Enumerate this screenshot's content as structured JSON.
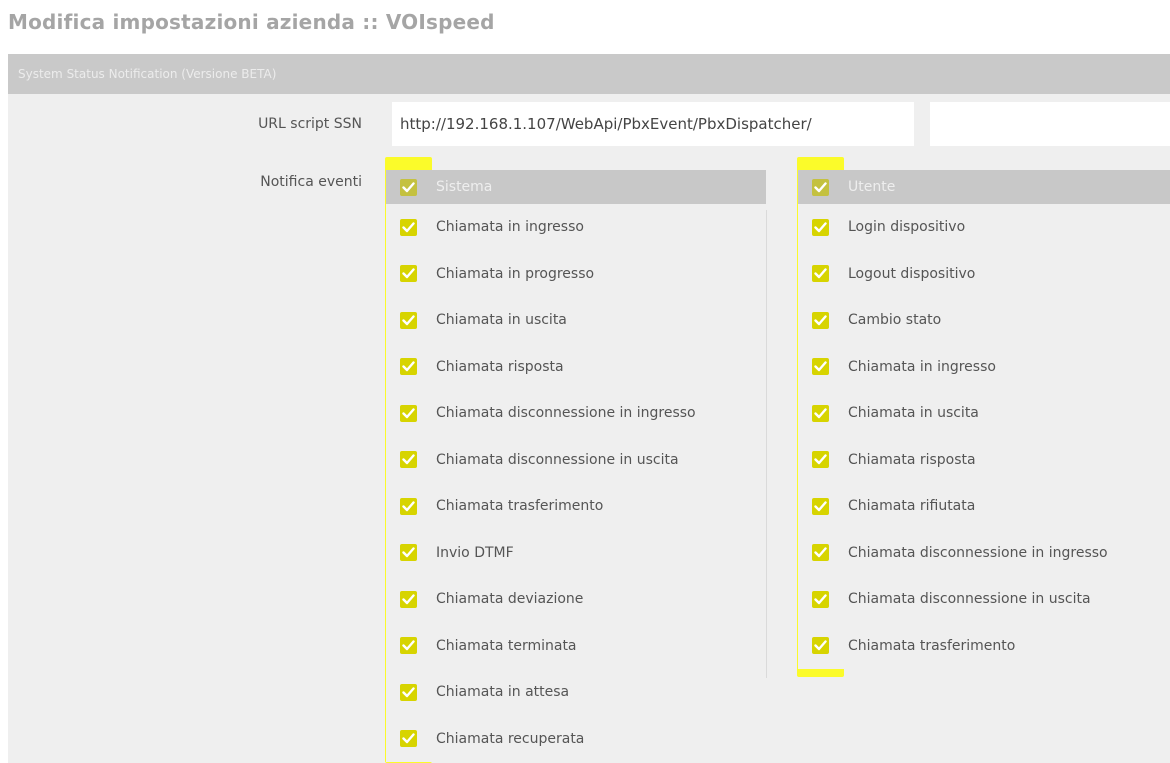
{
  "page": {
    "title": "Modifica impostazioni azienda :: VOIspeed"
  },
  "panel": {
    "header": "System Status Notification (Versione BETA)"
  },
  "form": {
    "url_label": "URL script SSN",
    "url_value": "http://192.168.1.107/WebApi/PbxEvent/PbxDispatcher/",
    "events_label": "Notifica eventi"
  },
  "colors": {
    "highlight": "#fbfb2a",
    "checkbox": "#d7d400",
    "header_bg": "#c8c8c8"
  },
  "system": {
    "header": "Sistema",
    "checked": true,
    "items": [
      {
        "label": "Chiamata in ingresso",
        "checked": true
      },
      {
        "label": "Chiamata in progresso",
        "checked": true
      },
      {
        "label": "Chiamata in uscita",
        "checked": true
      },
      {
        "label": "Chiamata risposta",
        "checked": true
      },
      {
        "label": "Chiamata disconnessione in ingresso",
        "checked": true
      },
      {
        "label": "Chiamata disconnessione in uscita",
        "checked": true
      },
      {
        "label": "Chiamata trasferimento",
        "checked": true
      },
      {
        "label": "Invio DTMF",
        "checked": true
      },
      {
        "label": "Chiamata deviazione",
        "checked": true
      },
      {
        "label": "Chiamata terminata",
        "checked": true
      },
      {
        "label": "Chiamata in attesa",
        "checked": true
      },
      {
        "label": "Chiamata recuperata",
        "checked": true
      }
    ]
  },
  "user": {
    "header": "Utente",
    "checked": true,
    "items": [
      {
        "label": "Login dispositivo",
        "checked": true
      },
      {
        "label": "Logout dispositivo",
        "checked": true
      },
      {
        "label": "Cambio stato",
        "checked": true
      },
      {
        "label": "Chiamata in ingresso",
        "checked": true
      },
      {
        "label": "Chiamata in uscita",
        "checked": true
      },
      {
        "label": "Chiamata risposta",
        "checked": true
      },
      {
        "label": "Chiamata rifiutata",
        "checked": true
      },
      {
        "label": "Chiamata disconnessione in ingresso",
        "checked": true
      },
      {
        "label": "Chiamata disconnessione in uscita",
        "checked": true
      },
      {
        "label": "Chiamata trasferimento",
        "checked": true
      }
    ]
  }
}
